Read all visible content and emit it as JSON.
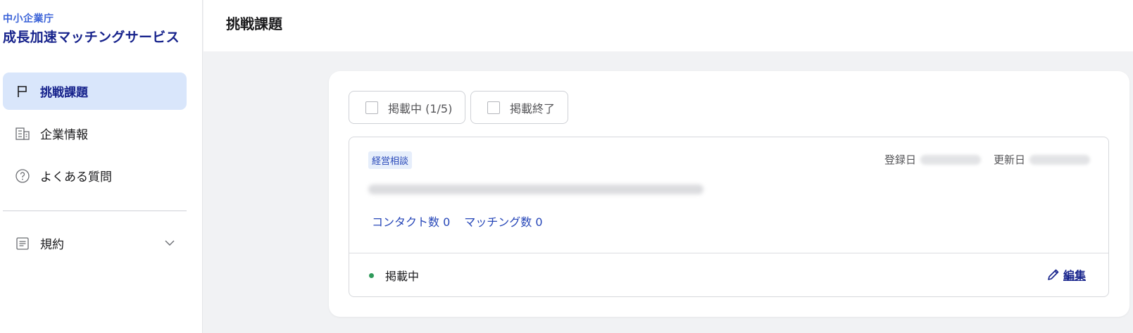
{
  "brand": {
    "org": "中小企業庁",
    "service": "成長加速マッチングサービス"
  },
  "sidebar": {
    "items": [
      {
        "label": "挑戦課題",
        "icon": "flag-icon",
        "active": true
      },
      {
        "label": "企業情報",
        "icon": "building-icon",
        "active": false
      },
      {
        "label": "よくある質問",
        "icon": "question-circle-icon",
        "active": false
      },
      {
        "label": "規約",
        "icon": "document-list-icon",
        "active": false,
        "expandable": true
      }
    ]
  },
  "header": {
    "title": "挑戦課題"
  },
  "filters": [
    {
      "label": "掲載中 (1/5)",
      "checked": false
    },
    {
      "label": "掲載終了",
      "checked": false
    }
  ],
  "card": {
    "tag": "経営相談",
    "registered_label": "登録日",
    "updated_label": "更新日",
    "contact_count": "コンタクト数 0",
    "matching_count": "マッチング数 0",
    "status": "掲載中",
    "status_color": "#2f9a5a",
    "edit_label": "編集"
  },
  "colors": {
    "brand_blue": "#17238c",
    "accent_blue": "#3b63d8",
    "active_nav_bg": "#d9e6fb",
    "tag_bg": "#e6eefb",
    "link_blue": "#2747b8"
  }
}
